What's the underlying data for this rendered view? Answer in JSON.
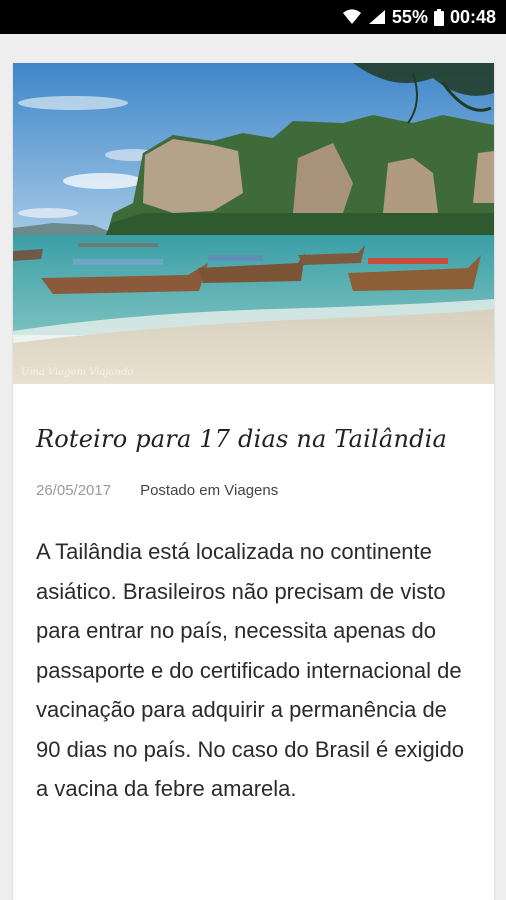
{
  "status_bar": {
    "battery_percent": "55%",
    "time": "00:48",
    "icons": [
      "wifi-icon",
      "signal-icon",
      "battery-icon"
    ]
  },
  "post": {
    "image_alt": "Praia na Tailândia com barcos",
    "image_watermark": "Uma Viagem Viajando",
    "title": "Roteiro para 17 dias na Tailândia",
    "date": "26/05/2017",
    "posted_in": "Postado em Viagens",
    "excerpt": "A Tailândia está localizada no continente asiático. Brasileiros não precisam de visto para entrar no país, necessita apenas do passaporte e do certificado internacional de vacinação para adquirir a permanência de 90 dias no país. No caso do Brasil é exigido a vacina da febre amarela."
  },
  "colors": {
    "status_bar_bg": "#000000",
    "page_bg": "#eeeeee",
    "card_bg": "#ffffff",
    "date_color": "#9a9a9a"
  }
}
